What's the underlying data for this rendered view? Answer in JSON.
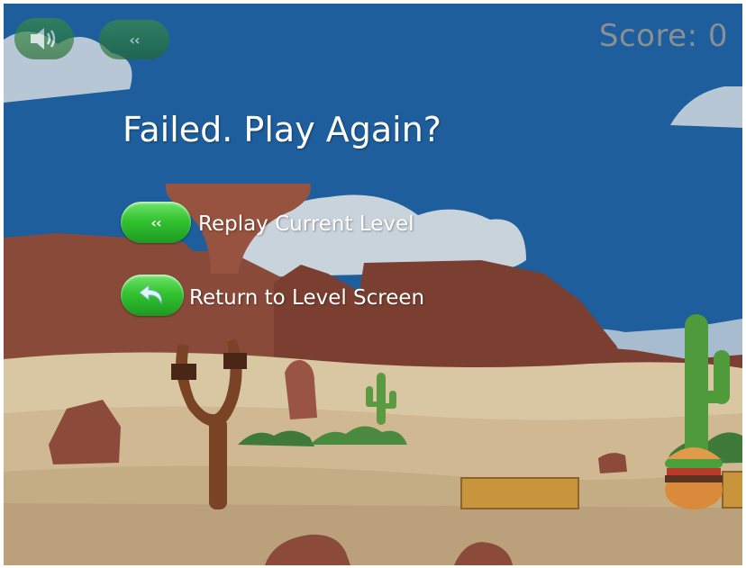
{
  "hud": {
    "sound_icon": "speaker-icon",
    "back_icon": "double-chevron-left-icon",
    "back_glyph": "‹‹",
    "score_label": "Score: 0"
  },
  "dialog": {
    "title": "Failed. Play Again?",
    "options": [
      {
        "label": "Replay Current Level",
        "icon": "double-chevron-left-icon",
        "glyph": "‹‹"
      },
      {
        "label": "Return to Level Screen",
        "icon": "return-arrow-icon"
      }
    ]
  },
  "colors": {
    "sky": "#1e5e9c",
    "button_green": "#33c331",
    "score_gray": "#8a8f93",
    "ground": "#d8c6a3"
  }
}
